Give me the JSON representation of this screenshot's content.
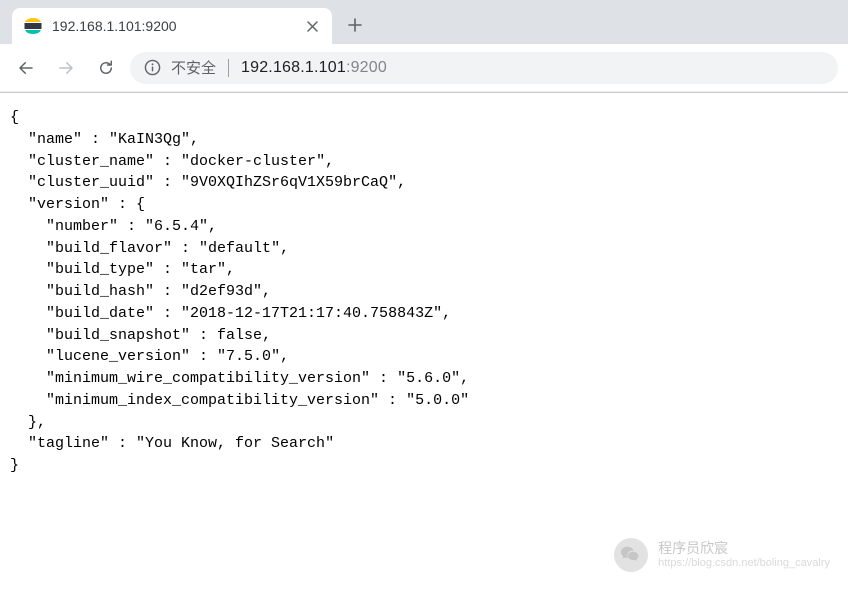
{
  "tab": {
    "title": "192.168.1.101:9200"
  },
  "addressbar": {
    "security_label": "不安全",
    "host": "192.168.1.101",
    "port": ":9200"
  },
  "response": {
    "name": "KaIN3Qg",
    "cluster_name": "docker-cluster",
    "cluster_uuid": "9V0XQIhZSr6qV1X59brCaQ",
    "version": {
      "number": "6.5.4",
      "build_flavor": "default",
      "build_type": "tar",
      "build_hash": "d2ef93d",
      "build_date": "2018-12-17T21:17:40.758843Z",
      "build_snapshot": "false",
      "lucene_version": "7.5.0",
      "minimum_wire_compatibility_version": "5.6.0",
      "minimum_index_compatibility_version": "5.0.0"
    },
    "tagline": "You Know, for Search"
  },
  "watermark": {
    "name": "程序员欣宸",
    "url": "https://blog.csdn.net/boling_cavalry"
  }
}
